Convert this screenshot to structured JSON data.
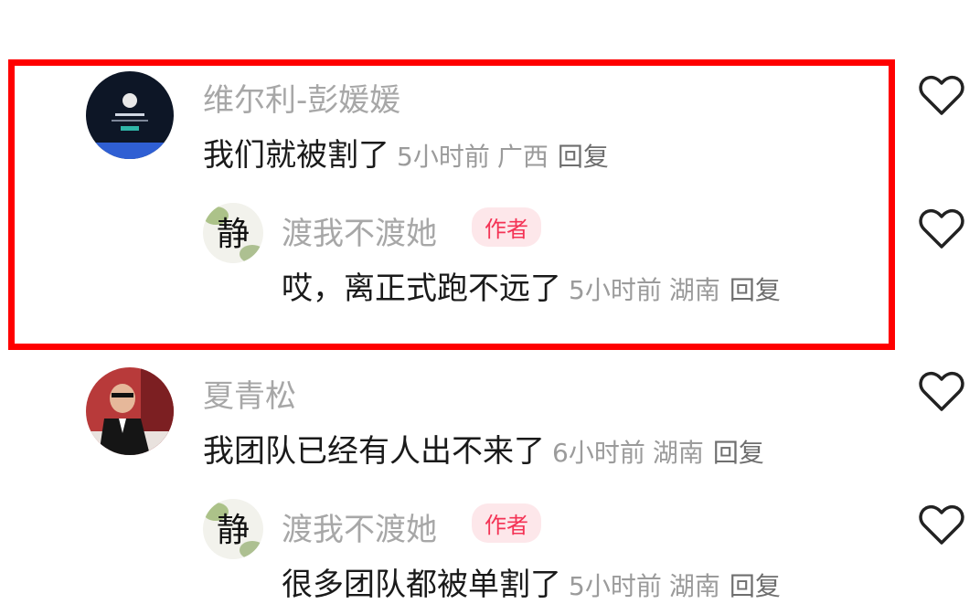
{
  "comments": [
    {
      "name": "维尔利-彭媛媛",
      "text": "我们就被割了",
      "time": "5小时前",
      "location": "广西",
      "reply_label": "回复",
      "replies": [
        {
          "name": "渡我不渡她",
          "badge": "作者",
          "text": "哎，离正式跑不远了",
          "time": "5小时前",
          "location": "湖南",
          "reply_label": "回复"
        }
      ]
    },
    {
      "name": "夏青松",
      "text": "我团队已经有人出不来了",
      "time": "6小时前",
      "location": "湖南",
      "reply_label": "回复",
      "replies": [
        {
          "name": "渡我不渡她",
          "badge": "作者",
          "text": "很多团队都被单割了",
          "time": "5小时前",
          "location": "湖南",
          "reply_label": "回复"
        }
      ]
    }
  ],
  "colors": {
    "highlight_border": "#ff0000",
    "author_badge_bg": "#fde7ea",
    "author_badge_text": "#f43355"
  },
  "icons": {
    "like": "heart-icon",
    "author_avatar_glyph": "静"
  }
}
